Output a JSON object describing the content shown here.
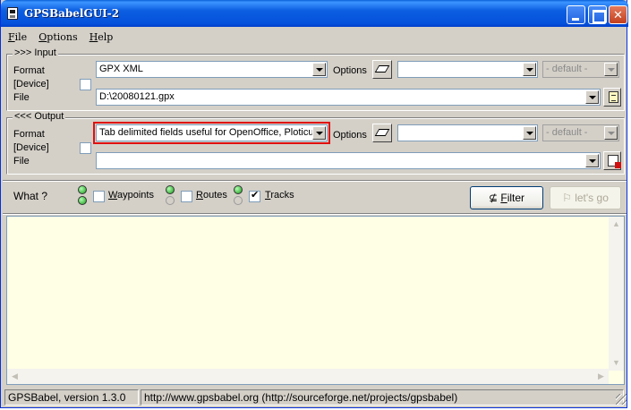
{
  "window": {
    "title": "GPSBabelGUI-2"
  },
  "menu": {
    "items": [
      "File",
      "Options",
      "Help"
    ],
    "underline": [
      "F",
      "O",
      "H"
    ]
  },
  "input": {
    "legend": ">>> Input",
    "format_label": "Format",
    "device_label": "[Device]",
    "file_label": "File",
    "format_value": "GPX XML",
    "options_label": "Options",
    "options_value": "",
    "charset_value": "- default -",
    "file_value": "D:\\20080121.gpx"
  },
  "output": {
    "legend": "<<< Output",
    "format_label": "Format",
    "device_label": "[Device]",
    "file_label": "File",
    "format_value": "Tab delimited fields useful for OpenOffice, Ploticus",
    "options_label": "Options",
    "options_value": "",
    "charset_value": "- default -",
    "file_value": ""
  },
  "what": {
    "label": "What ?",
    "waypoints": {
      "label": "Waypoints",
      "checked": false
    },
    "routes": {
      "label": "Routes",
      "checked": false
    },
    "tracks": {
      "label": "Tracks",
      "checked": true
    }
  },
  "buttons": {
    "filter": "Filter",
    "letsgo": "let's go"
  },
  "log": {
    "text": ""
  },
  "status": {
    "version": "GPSBabel, version 1.3.0",
    "url": "http://www.gpsbabel.org (http://sourceforge.net/projects/gpsbabel)"
  }
}
